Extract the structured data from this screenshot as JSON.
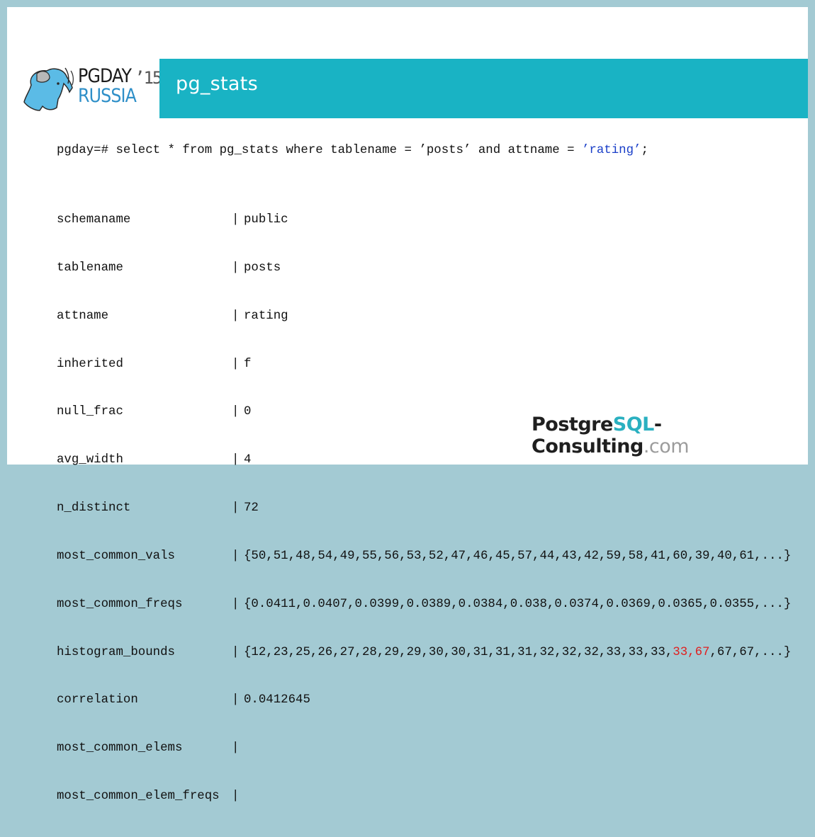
{
  "header": {
    "title": "pg_stats"
  },
  "logo": {
    "line1": "PGDAY",
    "year": "’15",
    "line2": "RUSSIA",
    "icon": "elephant-icon"
  },
  "query": {
    "prompt": "pgday=# ",
    "text_before": "select * from pg_stats where tablename = ’posts’ and attname = ",
    "highlighted": "’rating’",
    "text_after": ";"
  },
  "rows": [
    {
      "label": "schemaname",
      "value": "public"
    },
    {
      "label": "tablename",
      "value": "posts"
    },
    {
      "label": "attname",
      "value": "rating"
    },
    {
      "label": "inherited",
      "value": "f"
    },
    {
      "label": "null_frac",
      "value": "0"
    },
    {
      "label": "avg_width",
      "value": "4"
    },
    {
      "label": "n_distinct",
      "value": "72"
    },
    {
      "label": "most_common_vals",
      "value": "{50,51,48,54,49,55,56,53,52,47,46,45,57,44,43,42,59,58,41,60,39,40,61,...}"
    },
    {
      "label": "most_common_freqs",
      "value": "{0.0411,0.0407,0.0399,0.0389,0.0384,0.038,0.0374,0.0369,0.0365,0.0355,...}"
    },
    {
      "label": "histogram_bounds",
      "value_before": "{12,23,25,26,27,28,29,29,30,30,31,31,31,32,32,32,33,33,33,",
      "value_highlight": "33,67",
      "value_after": ",67,67,...}"
    },
    {
      "label": "correlation",
      "value": "0.0412645"
    },
    {
      "label": "most_common_elems",
      "value": ""
    },
    {
      "label": "most_common_elem_freqs",
      "value": ""
    }
  ],
  "pipe": "|",
  "footer": {
    "part1": "Postgre",
    "part2": "SQL",
    "part3": "-Consulting",
    "part4": ".com"
  },
  "colors": {
    "border": "#a3cad3",
    "banner": "#19b3c4",
    "highlight_red": "#e02020",
    "highlight_blue": "#1a3fc8"
  }
}
